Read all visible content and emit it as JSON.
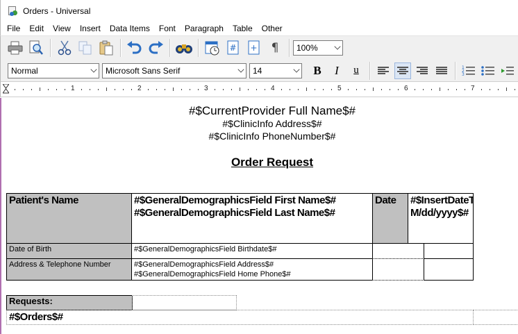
{
  "window": {
    "title": "Orders - Universal"
  },
  "menu": [
    "File",
    "Edit",
    "View",
    "Insert",
    "Data Items",
    "Font",
    "Paragraph",
    "Table",
    "Other"
  ],
  "toolbar": {
    "zoom": "100%"
  },
  "format": {
    "style": "Normal",
    "font": "Microsoft Sans Serif",
    "size": "14",
    "bold": "B",
    "italic": "I",
    "underline": "u"
  },
  "ruler": {
    "numbers": [
      "1",
      "2",
      "3",
      "4",
      "5",
      "6",
      "7"
    ]
  },
  "document": {
    "provider": "#$CurrentProvider Full Name$#",
    "clinic_address": "#$ClinicInfo Address$#",
    "clinic_phone": "#$ClinicInfo PhoneNumber$#",
    "heading": "Order Request ",
    "patient_label": "Patient's Name",
    "patient_first": "#$GeneralDemographicsField First Name$#",
    "patient_last": "#$GeneralDemographicsField Last Name$#",
    "date_label": "Date",
    "date_value": "#$InsertDateTime M/dd/yyyy$#",
    "dob_label": "Date of Birth",
    "dob_value": "#$GeneralDemographicsField Birthdate$#",
    "address_label": "Address & Telephone Number",
    "address_value": "#$GeneralDemographicsField Address$#",
    "phone_value": "#$GeneralDemographicsField Home Phone$#",
    "requests_label": "Requests:",
    "orders_value": "#$Orders$#"
  }
}
